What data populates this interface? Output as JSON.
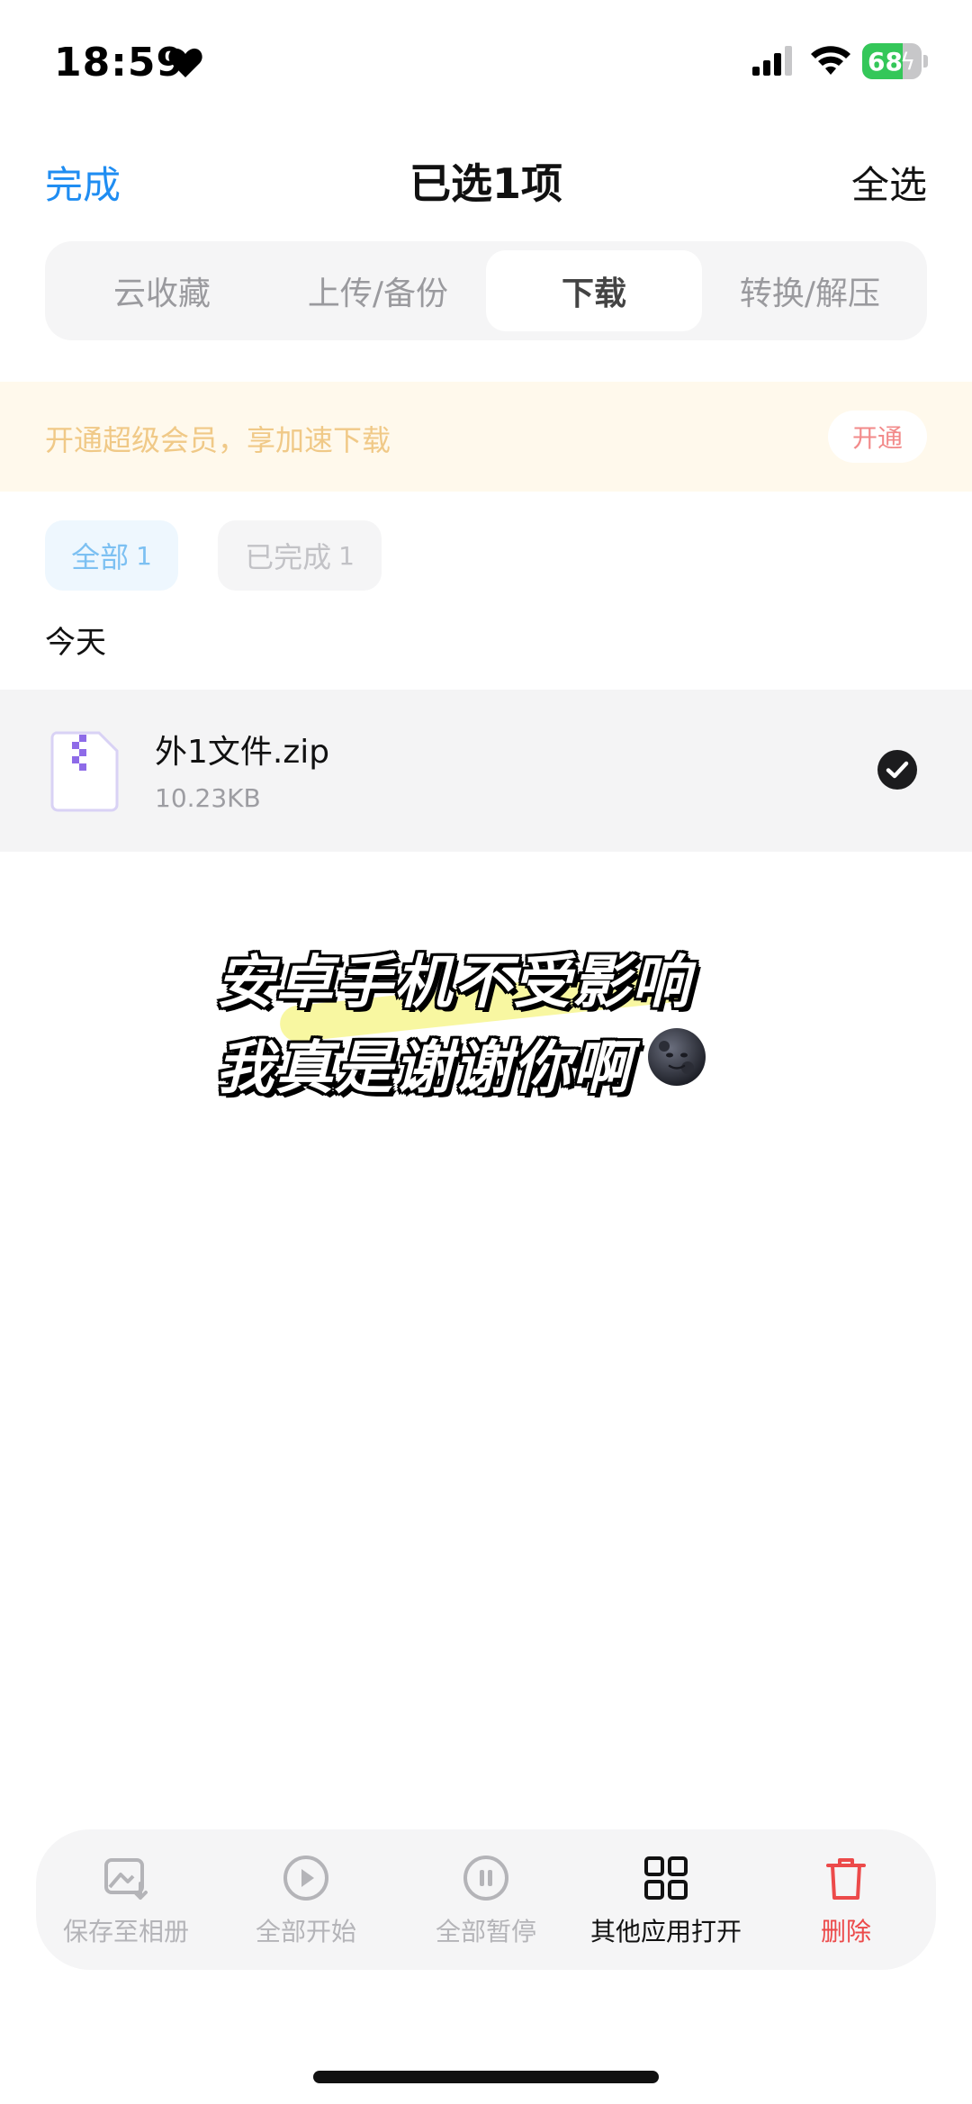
{
  "status_bar": {
    "time": "18:59",
    "battery_level": "68",
    "battery_percent": 68,
    "icons": [
      "heart-icon",
      "signal-icon",
      "wifi-icon",
      "battery-icon",
      "charging-bolt-icon"
    ]
  },
  "nav": {
    "done_label": "完成",
    "title": "已选1项",
    "select_all_label": "全选"
  },
  "tabs": [
    {
      "label": "云收藏",
      "active": false
    },
    {
      "label": "上传/备份",
      "active": false
    },
    {
      "label": "下载",
      "active": true
    },
    {
      "label": "转换/解压",
      "active": false
    }
  ],
  "vip_banner": {
    "text": "开通超级会员，享加速下载",
    "button_label": "开通"
  },
  "filters": {
    "all": {
      "label": "全部",
      "count": "1"
    },
    "completed": {
      "label": "已完成",
      "count": "1"
    }
  },
  "section_label": "今天",
  "files": [
    {
      "name": "外1文件.zip",
      "size": "10.23KB",
      "selected": true,
      "icon": "zip-file-icon"
    }
  ],
  "caption": {
    "line1": "安卓手机不受影响",
    "line2": "我真是谢谢你啊",
    "emoji": "new-moon-face-icon"
  },
  "toolbar": {
    "items": [
      {
        "label": "保存至相册",
        "icon": "save-to-album-icon",
        "state": "disabled"
      },
      {
        "label": "全部开始",
        "icon": "play-circle-icon",
        "state": "disabled"
      },
      {
        "label": "全部暂停",
        "icon": "pause-circle-icon",
        "state": "disabled"
      },
      {
        "label": "其他应用打开",
        "icon": "grid-apps-icon",
        "state": "enabled"
      },
      {
        "label": "删除",
        "icon": "trash-icon",
        "state": "danger"
      }
    ]
  },
  "colors": {
    "accent_blue": "#1f8df2",
    "danger_red": "#ec4a4a",
    "vip_gold": "#f0c987",
    "battery_green": "#34c759"
  }
}
